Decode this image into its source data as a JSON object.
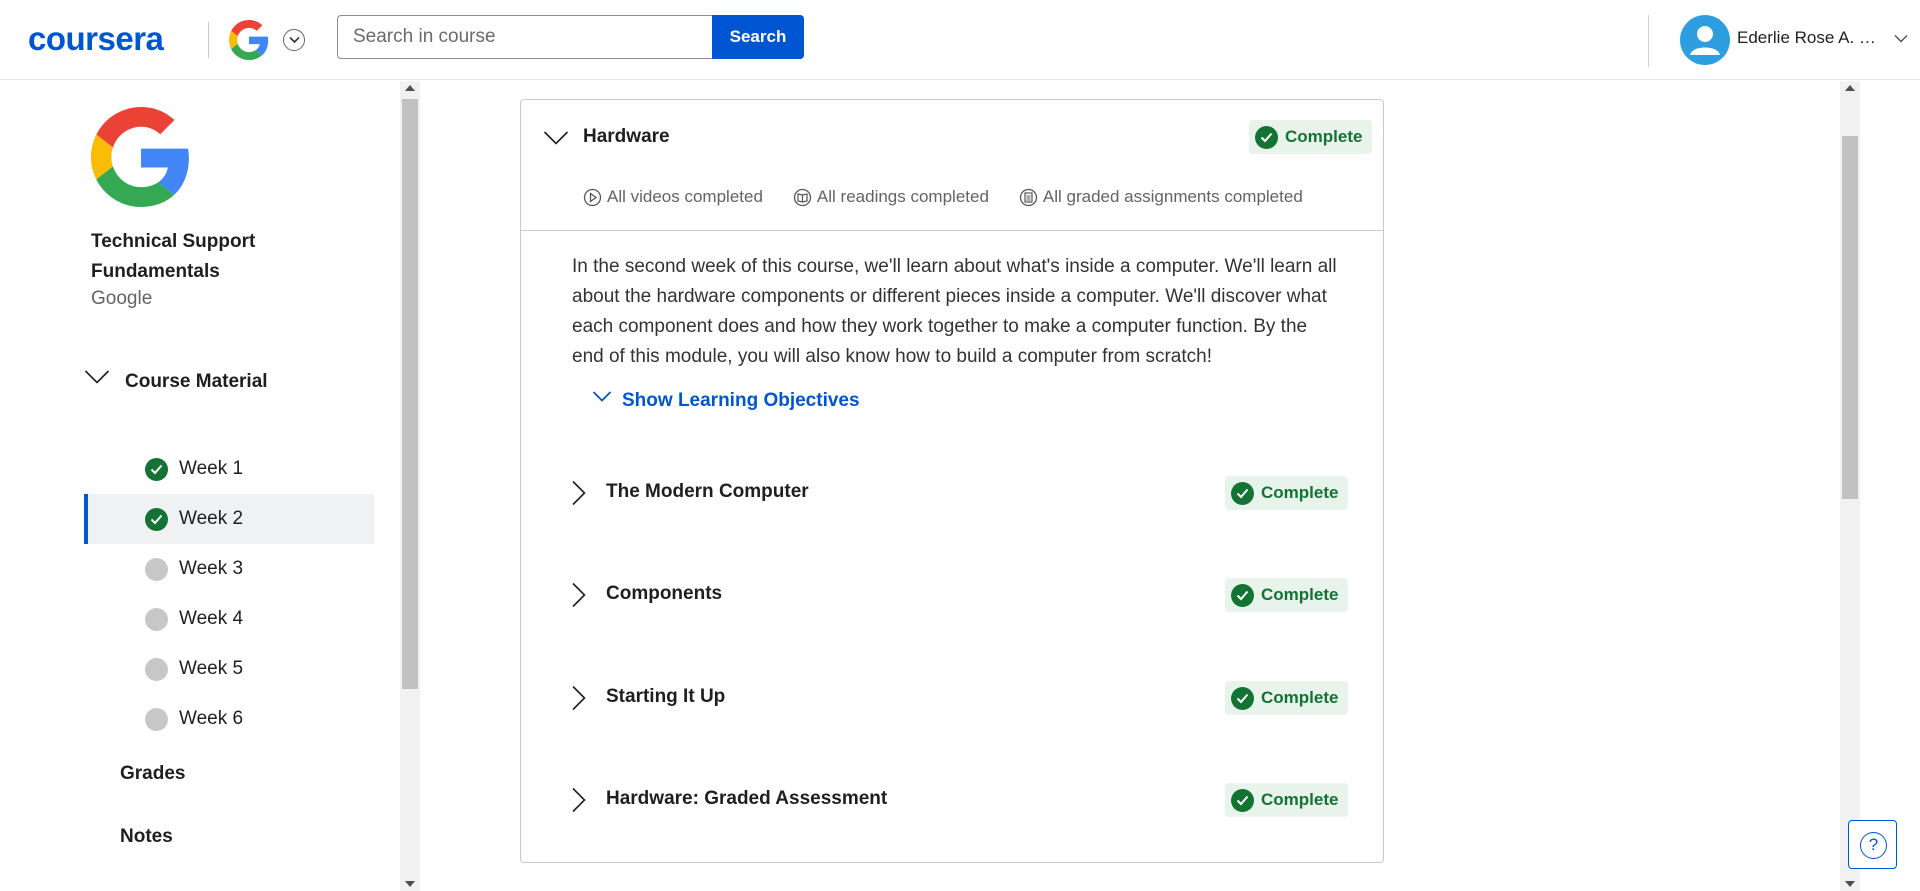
{
  "header": {
    "logo": "coursera",
    "search_placeholder": "Search in course",
    "search_button": "Search",
    "user_name": "Ederlie Rose A. Le…",
    "partner_logo": "google-g-logo"
  },
  "sidebar": {
    "course_title": "Technical Support Fundamentals",
    "partner": "Google",
    "section_label": "Course Material",
    "weeks": [
      {
        "label": "Week 1",
        "status": "complete"
      },
      {
        "label": "Week 2",
        "status": "complete"
      },
      {
        "label": "Week 3",
        "status": "incomplete"
      },
      {
        "label": "Week 4",
        "status": "incomplete"
      },
      {
        "label": "Week 5",
        "status": "incomplete"
      },
      {
        "label": "Week 6",
        "status": "incomplete"
      }
    ],
    "active_week": "Week 2",
    "links": [
      "Grades",
      "Notes"
    ]
  },
  "module": {
    "title": "Hardware",
    "status": "Complete",
    "stats": [
      "All videos completed",
      "All readings completed",
      "All graded assignments completed"
    ],
    "description": "In the second week of this course, we'll learn about what's inside a computer. We'll learn all about the hardware components or different pieces inside a computer. We'll discover what each component does and how they work together to make a computer function. By the end of this module, you will also know how to build a computer from scratch!",
    "objectives_label": "Show Learning Objectives",
    "lessons": [
      {
        "title": "The Modern Computer",
        "status": "Complete"
      },
      {
        "title": "Components",
        "status": "Complete"
      },
      {
        "title": "Starting It Up",
        "status": "Complete"
      },
      {
        "title": "Hardware: Graded Assessment",
        "status": "Complete"
      }
    ]
  },
  "help": {
    "label": "?"
  },
  "colors": {
    "brand": "#0056d2",
    "complete": "#137333",
    "complete_bg": "#e8f3ec"
  }
}
